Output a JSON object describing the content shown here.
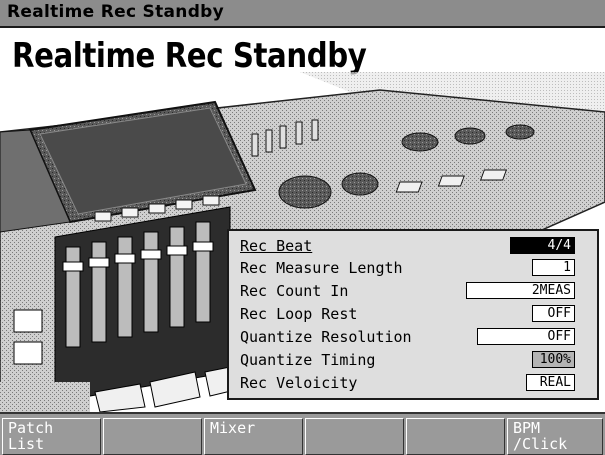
{
  "titlebar": {
    "title": "Realtime Rec Standby"
  },
  "heading": "Realtime Rec Standby",
  "params": [
    {
      "label": "Rec Beat",
      "value": "4/4"
    },
    {
      "label": "Rec Measure Length",
      "value": "1"
    },
    {
      "label": "Rec Count In",
      "value": "2MEAS"
    },
    {
      "label": "Rec Loop Rest",
      "value": "OFF"
    },
    {
      "label": "Quantize Resolution",
      "value": "OFF"
    },
    {
      "label": "Quantize Timing",
      "value": "100%"
    },
    {
      "label": "Rec Veloicity",
      "value": "REAL"
    }
  ],
  "function_buttons": [
    {
      "label": "Patch\nList"
    },
    {
      "label": ""
    },
    {
      "label": "Mixer"
    },
    {
      "label": ""
    },
    {
      "label": ""
    },
    {
      "label": "BPM\n/Click"
    }
  ],
  "colors": {
    "titlebar": "#8c8c8c",
    "panel": "#dedede",
    "selected_value": "#000000",
    "function_bar": "#9a9a9a"
  }
}
